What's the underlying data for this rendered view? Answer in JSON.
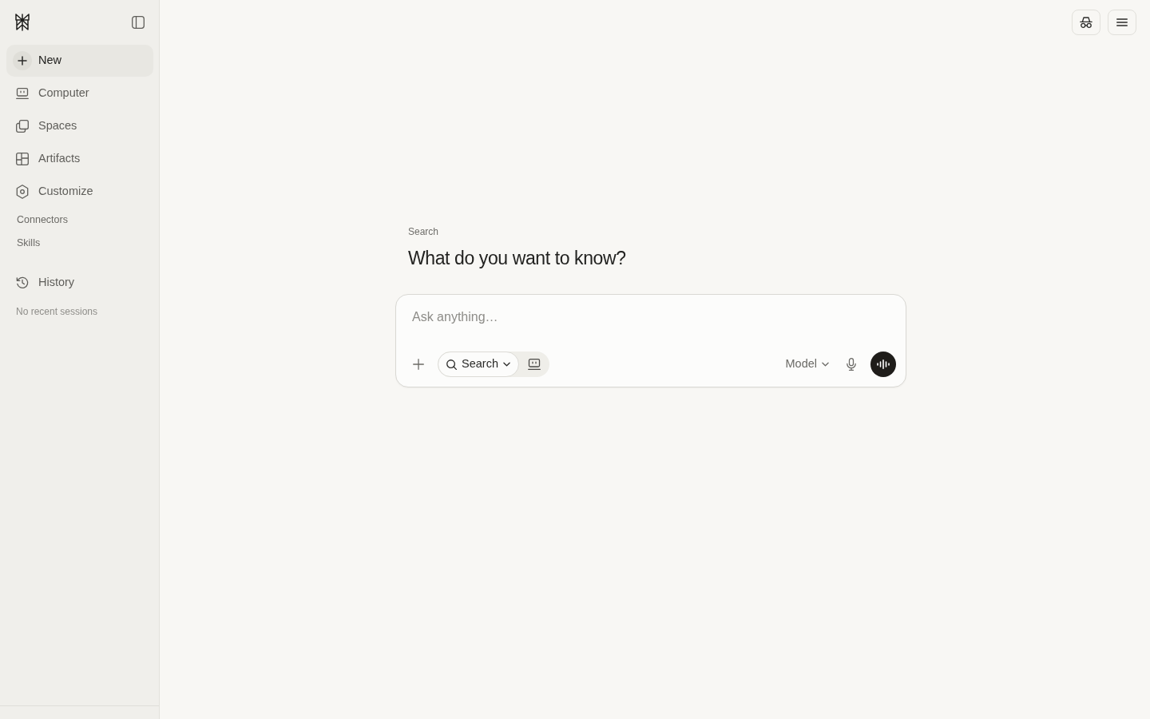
{
  "sidebar": {
    "items": [
      {
        "label": "New",
        "kind": "new"
      },
      {
        "label": "Computer",
        "kind": "computer"
      },
      {
        "label": "Spaces",
        "kind": "spaces"
      },
      {
        "label": "Artifacts",
        "kind": "artifacts"
      },
      {
        "label": "Customize",
        "kind": "customize"
      }
    ],
    "links": [
      "Connectors",
      "Skills"
    ],
    "history": {
      "label": "History",
      "empty_text": "No recent sessions"
    }
  },
  "main": {
    "eyebrow": "Search",
    "heading": "What do you want to know?",
    "composer": {
      "placeholder": "Ask anything…",
      "modes": [
        {
          "label": "Search",
          "kind": "search",
          "selected": true
        },
        {
          "kind": "computer",
          "selected": false
        }
      ],
      "model_label": "Model"
    }
  }
}
